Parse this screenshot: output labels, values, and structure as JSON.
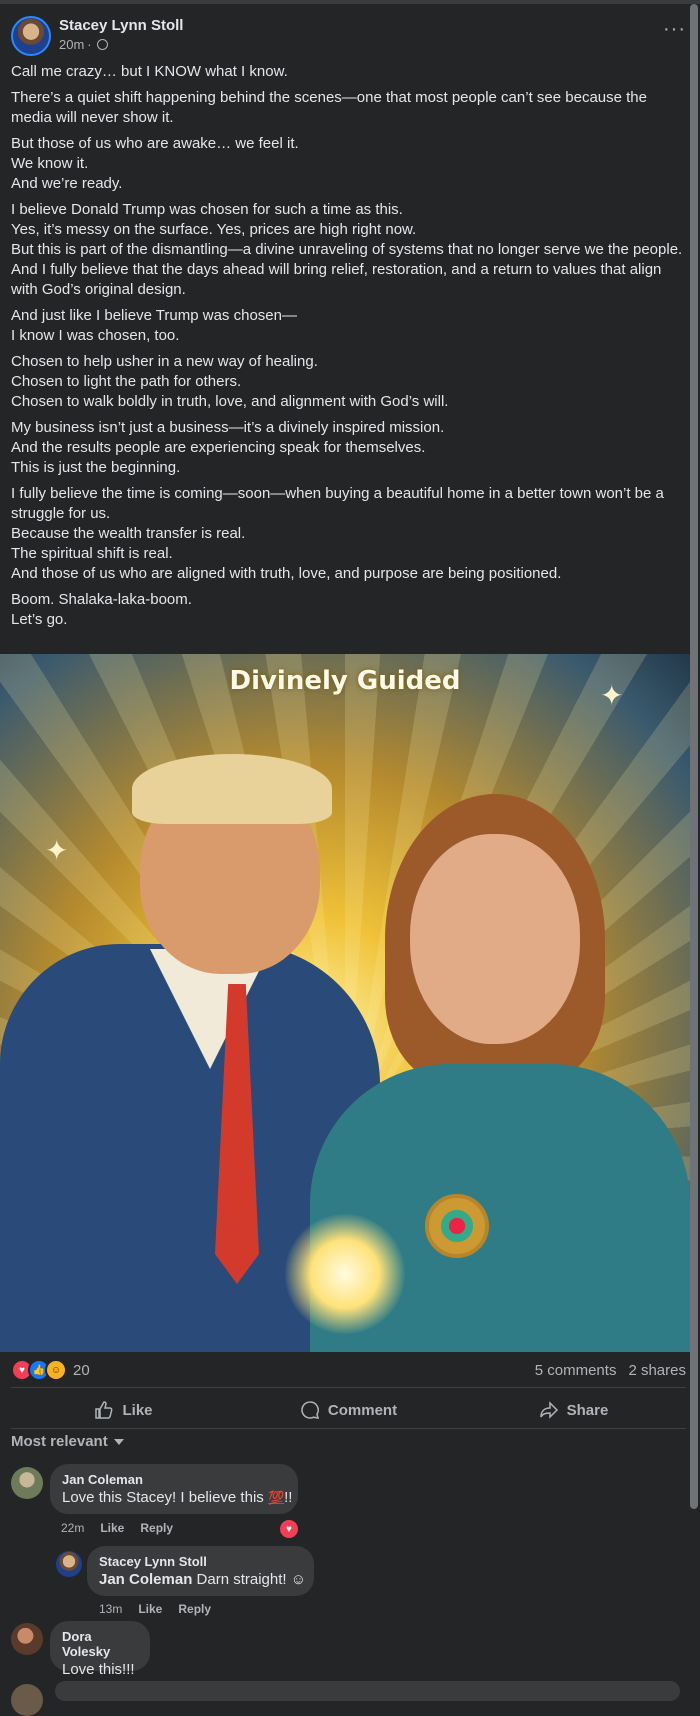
{
  "post": {
    "author": "Stacey Lynn Stoll",
    "time": "20m",
    "meta_separator": "·",
    "more_icon": "···",
    "paragraphs": [
      "Call me crazy… but I KNOW what I know.",
      "There’s a quiet shift happening behind the scenes—one that most people can’t see because the media will never show it.",
      "But those of us who are awake… we feel it.\nWe know it.\nAnd we’re ready.",
      "I believe Donald Trump was chosen for such a time as this.\nYes, it’s messy on the surface. Yes, prices are high right now.\nBut this is part of the dismantling—a divine unraveling of systems that no longer serve we the people.\nAnd I fully believe that the days ahead will bring relief, restoration, and a return to values that align with God’s original design.",
      "And just like I believe Trump was chosen—\nI know I was chosen, too.",
      "Chosen to help usher in a new way of healing.\nChosen to light the path for others.\nChosen to walk boldly in truth, love, and alignment with God’s will.",
      "My business isn’t just a business—it’s a divinely inspired mission.\nAnd the results people are experiencing speak for themselves.\nThis is just the beginning.",
      "I fully believe the time is coming—soon—when buying a beautiful home in a better town won’t be a struggle for us.\nBecause the wealth transfer is real.\nThe spiritual shift is real.\nAnd those of us who are aligned with truth, love, and purpose are being positioned.",
      "Boom. Shalaka-laka-boom.\nLet’s go."
    ],
    "image_title": "Divinely Guided"
  },
  "stats": {
    "reaction_count": "20",
    "comments": "5 comments",
    "shares": "2 shares",
    "reaction_icons": [
      "love-icon",
      "like-icon",
      "haha-icon"
    ]
  },
  "actions": {
    "like": "Like",
    "comment": "Comment",
    "share": "Share"
  },
  "sort_label": "Most relevant",
  "comments": [
    {
      "name": "Jan Coleman",
      "text": "Love this Stacey! I believe this ",
      "emoji": "💯",
      "tail": "!!",
      "time": "22m",
      "like": "Like",
      "reply": "Reply"
    },
    {
      "name": "Stacey Lynn Stoll",
      "mention": "Jan Coleman",
      "text": " Darn straight! ",
      "emoji": "☺",
      "time": "13m",
      "like": "Like",
      "reply": "Reply"
    },
    {
      "name": "Dora Volesky",
      "text": "Love this!!!"
    }
  ],
  "colors": {
    "background": "#242526",
    "bubble": "#3a3b3c",
    "primary_text": "#e4e6eb",
    "secondary_text": "#b0b3b8",
    "love": "#f33e58",
    "like": "#1877f2"
  }
}
